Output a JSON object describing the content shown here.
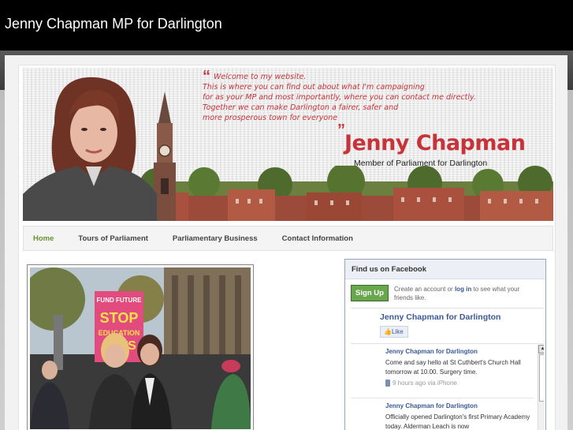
{
  "site": {
    "title": "Jenny Chapman MP for Darlington"
  },
  "banner": {
    "quote_lines": [
      "Welcome to my website.",
      "This is where you can find out about what I'm campaigning",
      "for as your MP and most importantly, where you can contact me directly.",
      "Together we can make Darlington a fairer, safer and",
      "more prosperous town for everyone"
    ],
    "name": "Jenny Chapman",
    "subtitle": "Member of Parliament for Darlington"
  },
  "nav": {
    "items": [
      {
        "label": "Home",
        "active": true
      },
      {
        "label": "Tours of Parliament",
        "active": false
      },
      {
        "label": "Parliamentary Business",
        "active": false
      },
      {
        "label": "Contact Information",
        "active": false
      }
    ]
  },
  "photo": {
    "placard": [
      "FUND",
      "FUTURE",
      "STOP",
      "EDUCATION",
      "CUTS"
    ]
  },
  "facebook": {
    "header": "Find us on Facebook",
    "signup_label": "Sign Up",
    "create_prefix": "Create an account or",
    "login_label": "log in",
    "create_suffix": "to see what your friends like.",
    "page_name": "Jenny Chapman for Darlington",
    "like_label": "Like",
    "posts": [
      {
        "author": "Jenny Chapman for Darlington",
        "text": "Come and say hello at St Cuthbert's Church Hall tomorrow at 10.00. Surgery time.",
        "meta": "9 hours ago via iPhone"
      },
      {
        "author": "Jenny Chapman for Darlington",
        "text": "Officially opened Darlington's first Primary Academy today. Alderman Leach is now"
      }
    ]
  },
  "colors": {
    "accent_green": "#66942d",
    "brand_red": "#c8333a",
    "fb_blue": "#3b5998"
  }
}
